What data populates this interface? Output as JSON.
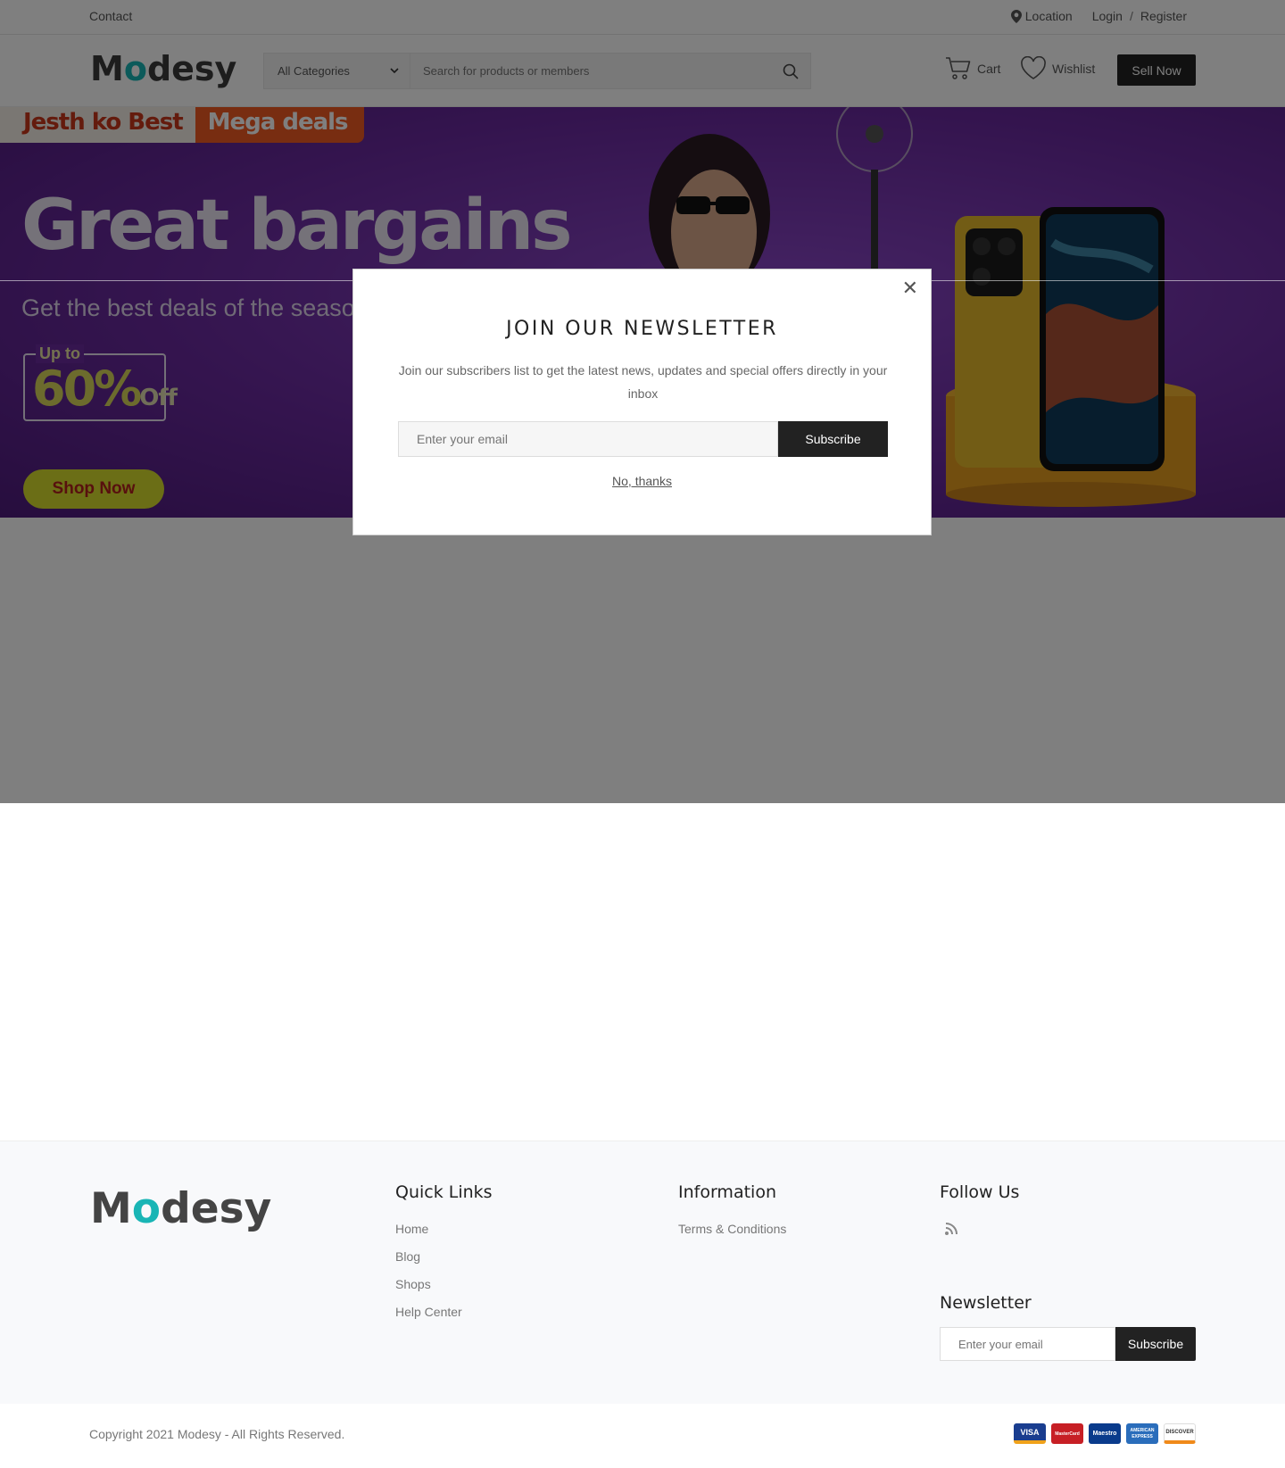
{
  "topbar": {
    "contact": "Contact",
    "location": "Location",
    "login": "Login",
    "separator": "/",
    "register": "Register"
  },
  "header": {
    "logo_m": "M",
    "logo_o": "o",
    "logo_rest": "desy",
    "category_select": "All Categories",
    "search_placeholder": "Search for products or members",
    "cart": "Cart",
    "wishlist": "Wishlist",
    "sell_now": "Sell Now"
  },
  "banner": {
    "tag1": "Jesth ko Best",
    "tag2": "Mega deals",
    "headline": "Great bargains",
    "subline": "Get the best deals of the seaso",
    "upto": "Up to",
    "percent": "60%",
    "off": "Off",
    "shop_now": "Shop Now",
    "colors": {
      "bg": "#6a2a9f",
      "accent": "#d6dd2c",
      "tag_orange": "#f15a22"
    }
  },
  "modal": {
    "title": "JOIN OUR NEWSLETTER",
    "description": "Join our subscribers list to get the latest news, updates and special offers directly in your inbox",
    "email_placeholder": "Enter your email",
    "subscribe": "Subscribe",
    "no_thanks": "No, thanks",
    "close_icon": "close-icon"
  },
  "footer": {
    "logo_m": "M",
    "logo_o": "o",
    "logo_rest": "desy",
    "quick_links": {
      "title": "Quick Links",
      "items": [
        "Home",
        "Blog",
        "Shops",
        "Help Center"
      ]
    },
    "information": {
      "title": "Information",
      "items": [
        "Terms & Conditions"
      ]
    },
    "follow": {
      "title": "Follow Us",
      "icon": "rss-icon"
    },
    "newsletter": {
      "title": "Newsletter",
      "placeholder": "Enter your email",
      "subscribe": "Subscribe"
    }
  },
  "bottom": {
    "copyright": "Copyright 2021 Modesy - All Rights Reserved.",
    "cards": [
      "VISA",
      "MasterCard",
      "Maestro",
      "AMERICAN EXPRESS",
      "DISCOVER"
    ]
  },
  "colors": {
    "brand_teal": "#19b5b5",
    "dark_button": "#222222"
  }
}
